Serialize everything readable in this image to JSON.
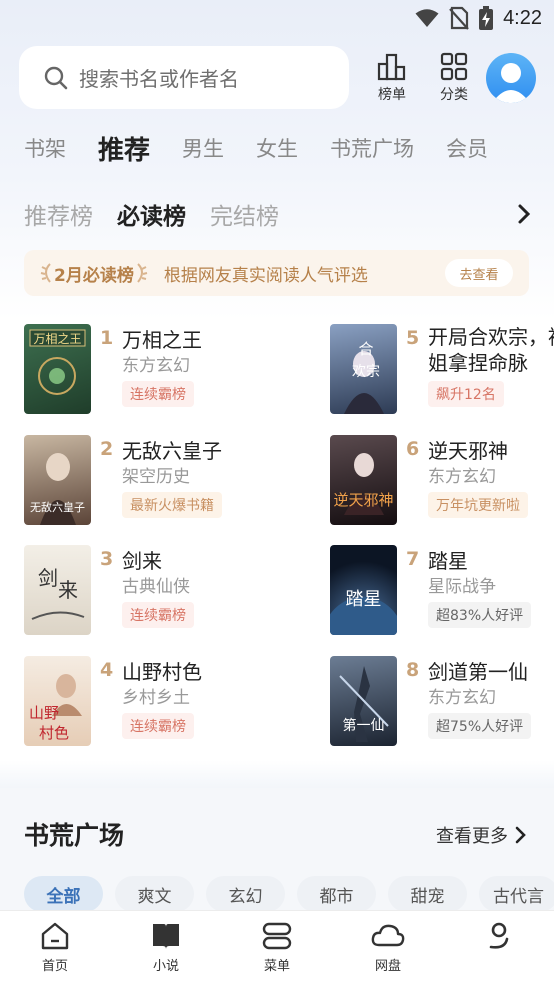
{
  "status_bar": {
    "time": "4:22"
  },
  "search": {
    "placeholder": "搜索书名或作者名"
  },
  "top_buttons": {
    "rank_label": "榜单",
    "category_label": "分类"
  },
  "main_tabs": [
    "书架",
    "推荐",
    "男生",
    "女生",
    "书荒广场",
    "会员"
  ],
  "main_tab_active": "推荐",
  "sub_tabs": [
    "推荐榜",
    "必读榜",
    "完结榜"
  ],
  "sub_tab_active": "必读榜",
  "banner": {
    "title": "2月必读榜",
    "description": "根据网友真实阅读人气评选",
    "button_label": "去查看"
  },
  "books": [
    {
      "rank": "1",
      "title": "万相之王",
      "genre": "东方玄幻",
      "tag": "连续霸榜",
      "tag_style": "red",
      "cover_text": "万相之王",
      "cover_color": "#2f5a3b"
    },
    {
      "rank": "2",
      "title": "无敌六皇子",
      "genre": "架空历史",
      "tag": "最新火爆书籍",
      "tag_style": "orange",
      "cover_text": "无敌六皇子",
      "cover_color": "#6b5346"
    },
    {
      "rank": "3",
      "title": "剑来",
      "genre": "古典仙侠",
      "tag": "连续霸榜",
      "tag_style": "red",
      "cover_text": "剑来",
      "cover_color": "#e9e4da"
    },
    {
      "rank": "4",
      "title": "山野村色",
      "genre": "乡村乡土",
      "tag": "连续霸榜",
      "tag_style": "red",
      "cover_text": "山野村色",
      "cover_color": "#efe2d3"
    },
    {
      "rank": "5",
      "title": "开局合欢宗，被女帝师姐拿捏命脉",
      "title_line1": "开局合欢宗，被",
      "title_line2": "姐拿捏命脉",
      "genre": "",
      "tag": "飙升12名",
      "tag_style": "red",
      "cover_text": "合欢宗",
      "cover_color": "#3e4f6a"
    },
    {
      "rank": "6",
      "title": "逆天邪神",
      "genre": "东方玄幻",
      "tag": "万年坑更新啦",
      "tag_style": "orange",
      "cover_text": "逆天邪神",
      "cover_color": "#2b1f24"
    },
    {
      "rank": "7",
      "title": "踏星",
      "genre": "星际战争",
      "tag": "超83%人好评",
      "tag_style": "grey",
      "cover_text": "踏星",
      "cover_color": "#1f3654"
    },
    {
      "rank": "8",
      "title": "剑道第一仙",
      "genre": "东方玄幻",
      "tag": "超75%人好评",
      "tag_style": "grey",
      "cover_text": "第一仙",
      "cover_color": "#2e3a4c"
    }
  ],
  "square": {
    "title": "书荒广场",
    "see_more": "查看更多",
    "chips": [
      "全部",
      "爽文",
      "玄幻",
      "都市",
      "甜宠",
      "古代言"
    ]
  },
  "bottom_nav": [
    {
      "label": "首页",
      "icon": "home-icon"
    },
    {
      "label": "小说",
      "icon": "book-icon"
    },
    {
      "label": "菜单",
      "icon": "menu-icon"
    },
    {
      "label": "网盘",
      "icon": "cloud-icon"
    },
    {
      "label": "",
      "icon": "profile-icon"
    }
  ],
  "colors": {
    "accent_gold": "#b6814a",
    "rank_color": "#c9a37a",
    "chip_active": "#3b72b8"
  }
}
